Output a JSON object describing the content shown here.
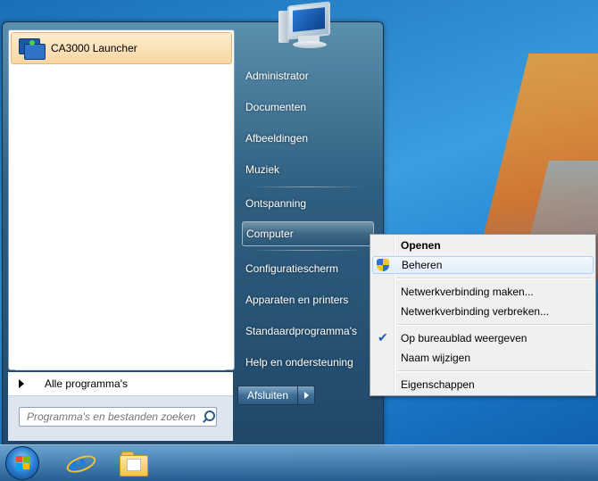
{
  "pinned": {
    "app_label": "CA3000 Launcher",
    "app_icon": "ca3000-launcher-icon"
  },
  "left_pane": {
    "all_programs": "Alle programma's",
    "search_placeholder": "Programma's en bestanden zoeken"
  },
  "right_pane": {
    "items": [
      "Administrator",
      "Documenten",
      "Afbeeldingen",
      "Muziek",
      "Ontspanning",
      "Computer",
      "Configuratiescherm",
      "Apparaten en printers",
      "Standaardprogramma's",
      "Help en ondersteuning"
    ],
    "shutdown_label": "Afsluiten"
  },
  "context_menu": {
    "items": [
      {
        "label": "Openen",
        "bold": true
      },
      {
        "label": "Beheren",
        "icon": "uac-shield-icon"
      },
      {
        "label": "Netwerkverbinding maken..."
      },
      {
        "label": "Netwerkverbinding verbreken..."
      },
      {
        "label": "Op bureaublad weergeven",
        "checked": true
      },
      {
        "label": "Naam wijzigen"
      },
      {
        "label": "Eigenschappen"
      }
    ]
  },
  "taskbar": {
    "icons": [
      "start-orb-icon",
      "internet-explorer-icon",
      "windows-explorer-icon"
    ]
  },
  "colors": {
    "accent": "#1f7fd0",
    "highlight": "#f8d6a3",
    "menu_bg": "#f0f0f0"
  }
}
